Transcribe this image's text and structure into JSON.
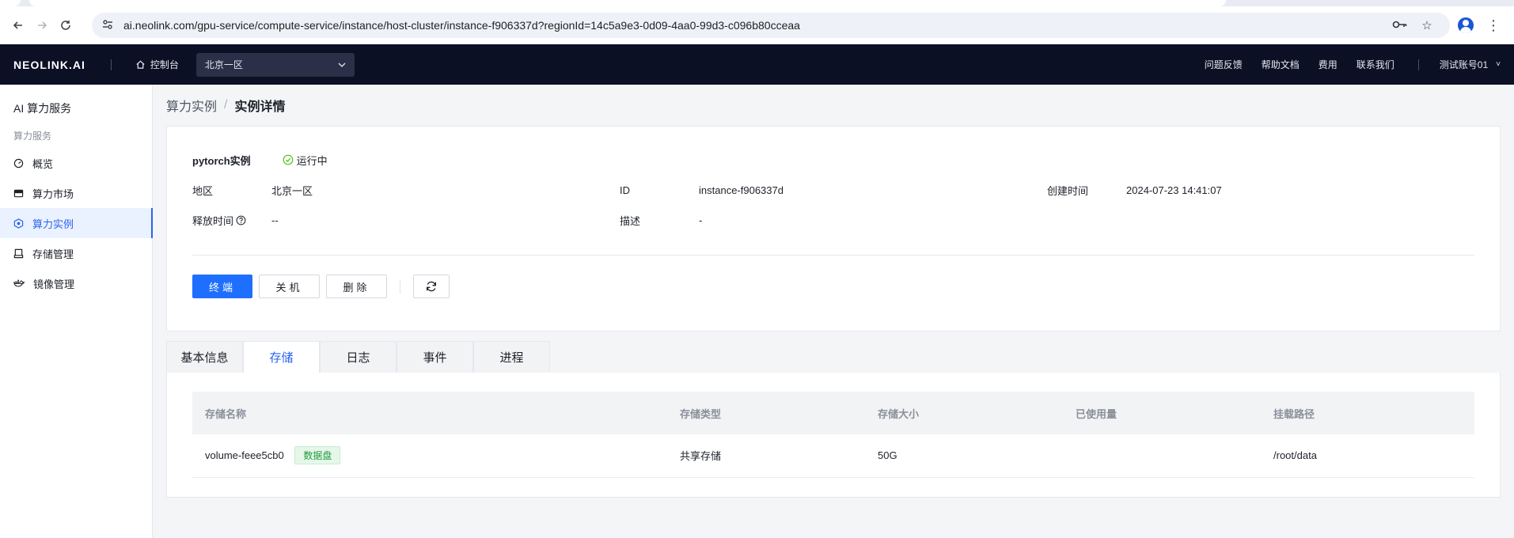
{
  "browser": {
    "url": "ai.neolink.com/gpu-service/compute-service/instance/host-cluster/instance-f906337d?regionId=14c5a9e3-0d09-4aa0-99d3-c096b80cceaa"
  },
  "header": {
    "logo": "NEOLINK.AI",
    "console_label": "控制台",
    "region": "北京一区",
    "links": [
      "问题反馈",
      "帮助文档",
      "费用",
      "联系我们"
    ],
    "account": "测试账号01"
  },
  "sidebar": {
    "title": "AI 算力服务",
    "section": "算力服务",
    "items": [
      {
        "label": "概览",
        "icon": "dashboard-icon"
      },
      {
        "label": "算力市场",
        "icon": "market-icon"
      },
      {
        "label": "算力实例",
        "icon": "instance-icon",
        "active": true
      },
      {
        "label": "存储管理",
        "icon": "storage-icon"
      },
      {
        "label": "镜像管理",
        "icon": "docker-icon"
      }
    ]
  },
  "breadcrumb": {
    "parent": "算力实例",
    "separator": "/",
    "current": "实例详情"
  },
  "instance": {
    "name": "pytorch实例",
    "status": "运行中",
    "fields": {
      "region_key": "地区",
      "region_val": "北京一区",
      "id_key": "ID",
      "id_val": "instance-f906337d",
      "created_key": "创建时间",
      "created_val": "2024-07-23 14:41:07",
      "release_key": "释放时间",
      "release_val": "--",
      "desc_key": "描述",
      "desc_val": "-"
    }
  },
  "actions": {
    "terminal": "终端",
    "shutdown": "关机",
    "delete": "删除"
  },
  "tabs": [
    "基本信息",
    "存储",
    "日志",
    "事件",
    "进程"
  ],
  "active_tab": 1,
  "storage_table": {
    "columns": [
      "存储名称",
      "存储类型",
      "存储大小",
      "已使用量",
      "挂载路径"
    ],
    "rows": [
      {
        "name": "volume-feee5cb0",
        "tag": "数据盘",
        "type": "共享存储",
        "size": "50G",
        "used": "",
        "path": "/root/data"
      }
    ]
  },
  "colors": {
    "primary": "#1f6fff",
    "header_bg": "#0c1024",
    "status_green": "#52c41a"
  }
}
